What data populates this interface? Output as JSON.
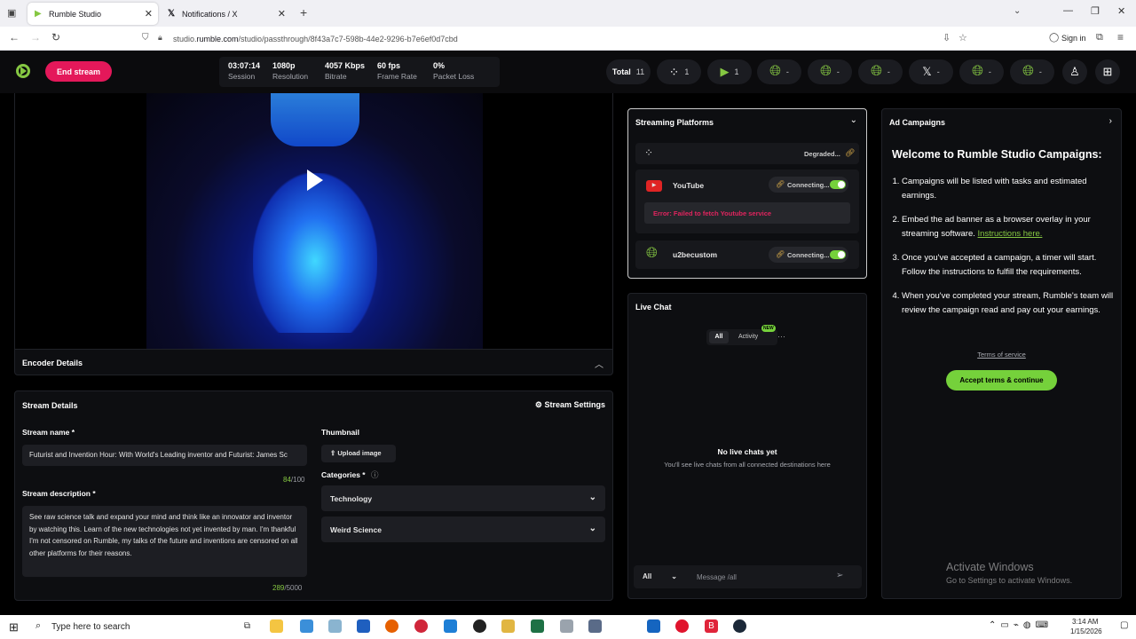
{
  "browser": {
    "tabs": [
      {
        "label": "Rumble Studio",
        "active": true
      },
      {
        "label": "Notifications / X",
        "active": false
      }
    ],
    "new_tab": "+",
    "url_domain": "rumble.com",
    "url_prefix": "studio.",
    "url_path": "/studio/passthrough/8f43a7c7-598b-44e2-9296-b7e6ef0d7cbd",
    "sign_in": "Sign in"
  },
  "header": {
    "end_stream": "End stream",
    "stats": [
      {
        "value": "03:07:14",
        "label": "Session"
      },
      {
        "value": "1080p",
        "label": "Resolution"
      },
      {
        "value": "4057 Kbps",
        "label": "Bitrate"
      },
      {
        "value": "60 fps",
        "label": "Frame Rate"
      },
      {
        "value": "0%",
        "label": "Packet Loss"
      }
    ],
    "total_label": "Total",
    "total_value": "11",
    "dest_counts": [
      "1",
      "1",
      "-",
      "-",
      "-",
      "-",
      "-",
      "-"
    ]
  },
  "encoder": {
    "title": "Encoder Details"
  },
  "stream_details": {
    "title": "Stream Details",
    "settings": "Stream Settings",
    "name_label": "Stream name *",
    "name_value": "Futurist and Invention Hour: With World's Leading inventor and Futurist: James Sc",
    "name_count": "84",
    "name_max": "/100",
    "desc_label": "Stream description *",
    "desc_value": "See raw science talk and expand your mind and think like an innovator and inventor by watching this. Learn of the new technologies not yet invented by man. I'm thankful I'm not censored on Rumble, my talks of the future and inventions are censored on all other platforms for their reasons.",
    "desc_count": "289",
    "desc_max": "/5000",
    "thumb_label": "Thumbnail",
    "upload": "Upload image",
    "categories_label": "Categories *",
    "cat1": "Technology",
    "cat2": "Weird Science"
  },
  "platforms": {
    "title": "Streaming Platforms",
    "rumble_status": "Degraded...",
    "youtube_name": "YouTube",
    "youtube_status": "Connecting...",
    "error": "Error: Failed to fetch Youtube service",
    "custom_name": "u2becustom",
    "custom_status": "Connecting..."
  },
  "chat": {
    "title": "Live Chat",
    "tab_all": "All",
    "tab_activity": "Activity",
    "new_badge": "NEW",
    "more": "···",
    "empty_title": "No live chats yet",
    "empty_sub": "You'll see live chats from all connected destinations here",
    "select_value": "All",
    "placeholder": "Message /all"
  },
  "ads": {
    "title": "Ad Campaigns",
    "welcome": "Welcome to Rumble Studio Campaigns:",
    "items": [
      "Campaigns will be listed with tasks and estimated earnings.",
      "Embed the ad banner as a browser overlay in your streaming software.",
      "Once you've accepted a campaign, a timer will start. Follow the instructions to fulfill the requirements.",
      "When you've completed your stream, Rumble's team will review the campaign read and pay out your earnings."
    ],
    "instructions_link": "Instructions here.",
    "terms": "Terms of service",
    "accept": "Accept terms & continue",
    "watermark1": "Activate Windows",
    "watermark2": "Go to Settings to activate Windows."
  },
  "taskbar": {
    "search": "Type here to search",
    "time": "3:14 AM",
    "date": "1/15/2026"
  },
  "colors": {
    "accent_green": "#85c742",
    "end_red": "#e4185a",
    "error_red": "#e0245e"
  }
}
